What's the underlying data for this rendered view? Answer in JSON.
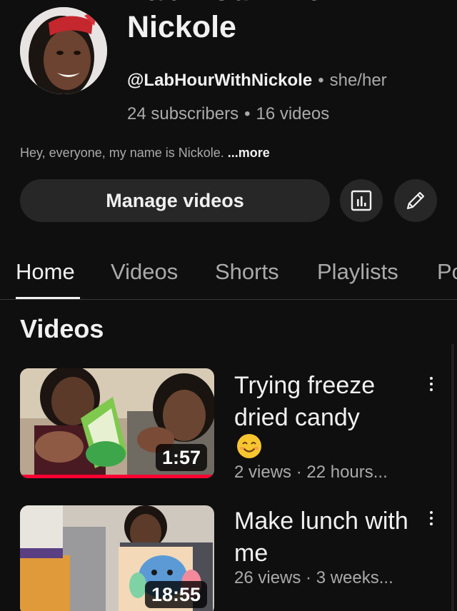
{
  "channel": {
    "name_partial": "Lab Hour With",
    "name_line2": "Nickole",
    "handle": "@LabHourWithNickole",
    "pronouns": "she/her",
    "subscribers": "24 subscribers",
    "videos_count": "16 videos",
    "description": "Hey, everyone, my name is Nickole.",
    "more_label": "...more",
    "separator": "•"
  },
  "actions": {
    "manage_label": "Manage videos",
    "analytics_icon": "analytics-icon",
    "edit_icon": "pencil-icon"
  },
  "tabs": [
    {
      "label": "Home",
      "active": true
    },
    {
      "label": "Videos",
      "active": false
    },
    {
      "label": "Shorts",
      "active": false
    },
    {
      "label": "Playlists",
      "active": false
    },
    {
      "label": "Po",
      "active": false
    }
  ],
  "section_title": "Videos",
  "videos": [
    {
      "title": "Trying freeze dried candy",
      "emoji": "😊",
      "duration": "1:57",
      "meta": "2 views · 22 hours...",
      "watched_fraction": 1.0
    },
    {
      "title": "Make lunch with me",
      "duration": "18:55",
      "meta": "26 views · 3 weeks..."
    }
  ],
  "colors": {
    "background": "#0f0f0f",
    "surface": "#272727",
    "text_primary": "#f1f1f1",
    "text_secondary": "#aaaaaa",
    "progress": "#ff0033"
  }
}
